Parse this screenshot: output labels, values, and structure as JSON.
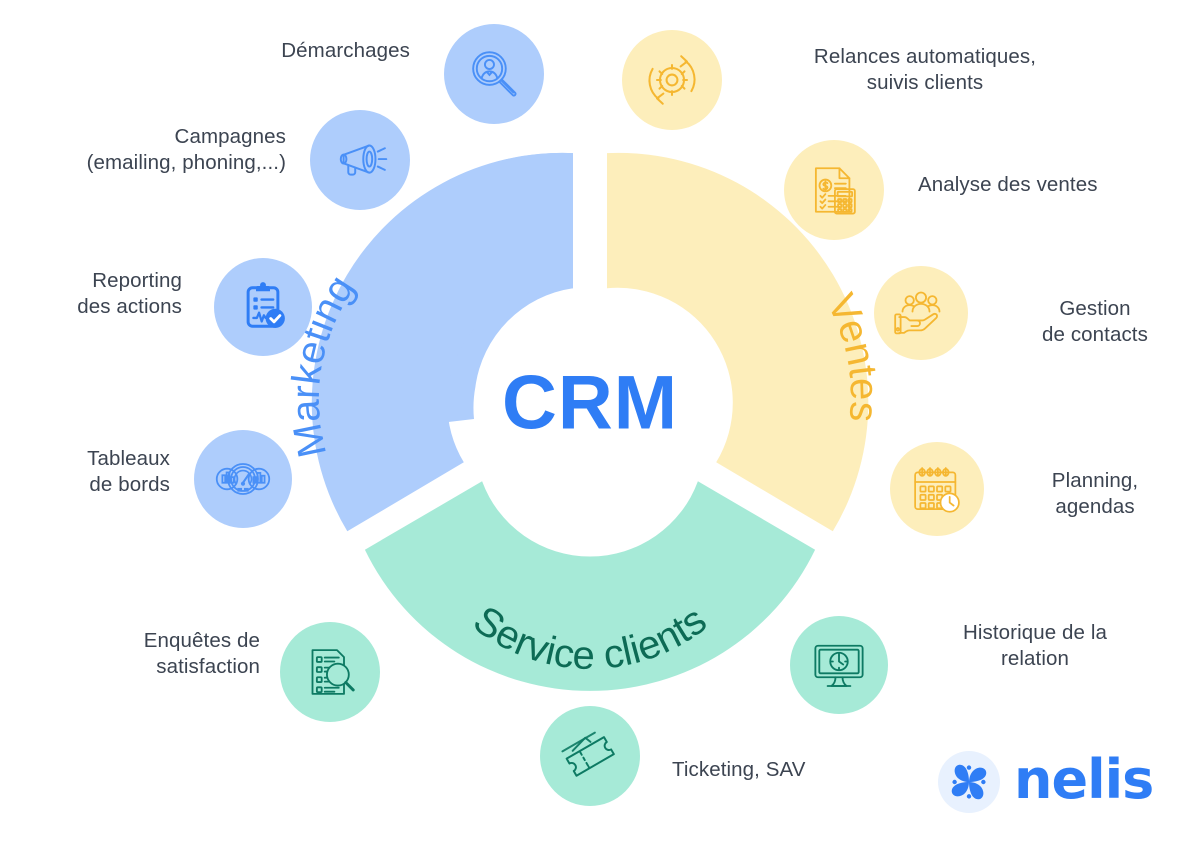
{
  "center": {
    "title": "CRM",
    "title_color": "#2f7df5"
  },
  "segments": [
    {
      "id": "marketing",
      "label": "Marketing",
      "fill": "#aecdfc",
      "text_color": "#4a90f7"
    },
    {
      "id": "ventes",
      "label": "Ventes",
      "fill": "#fdeebb",
      "text_color": "#f5b731"
    },
    {
      "id": "service-clients",
      "label": "Service clients",
      "fill": "#a6ead7",
      "text_color": "#0d6b55"
    }
  ],
  "features": [
    {
      "id": "demarchages",
      "label": "Démarchages",
      "group": "marketing",
      "icon": "person-magnifier-icon",
      "bubble_color": "#aecdfc",
      "icon_color": "#4a90f7"
    },
    {
      "id": "campagnes",
      "label": "Campagnes\n(emailing, phoning,...)",
      "group": "marketing",
      "icon": "megaphone-icon",
      "bubble_color": "#aecdfc",
      "icon_color": "#4a90f7"
    },
    {
      "id": "reporting-des-actions",
      "label": "Reporting\ndes actions",
      "group": "marketing",
      "icon": "clipboard-check-icon",
      "bubble_color": "#aecdfc",
      "icon_color": "#2f7df5"
    },
    {
      "id": "tableaux-de-bords",
      "label": "Tableaux\nde bords",
      "group": "marketing",
      "icon": "dashboard-gauge-icon",
      "bubble_color": "#aecdfc",
      "icon_color": "#4a90f7"
    },
    {
      "id": "relances-automatiques",
      "label": "Relances automatiques,\nsuivis clients",
      "group": "ventes",
      "icon": "gear-refresh-icon",
      "bubble_color": "#fdeebb",
      "icon_color": "#f5b731"
    },
    {
      "id": "analyse-des-ventes",
      "label": "Analyse des ventes",
      "group": "ventes",
      "icon": "invoice-calculator-icon",
      "bubble_color": "#fdeebb",
      "icon_color": "#f5b731"
    },
    {
      "id": "gestion-de-contacts",
      "label": "Gestion\nde contacts",
      "group": "ventes",
      "icon": "hand-people-icon",
      "bubble_color": "#fdeebb",
      "icon_color": "#f5b731"
    },
    {
      "id": "planning-agendas",
      "label": "Planning,\nagendas",
      "group": "ventes",
      "icon": "calendar-clock-icon",
      "bubble_color": "#fdeebb",
      "icon_color": "#f5b731"
    },
    {
      "id": "enquetes-de-satisfaction",
      "label": "Enquêtes de\nsatisfaction",
      "group": "service-clients",
      "icon": "survey-magnifier-icon",
      "bubble_color": "#a6ead7",
      "icon_color": "#0d7a63"
    },
    {
      "id": "ticketing-sav",
      "label": "Ticketing, SAV",
      "group": "service-clients",
      "icon": "tickets-icon",
      "bubble_color": "#a6ead7",
      "icon_color": "#0d7a63"
    },
    {
      "id": "historique-de-la-relation",
      "label": "Historique de la\nrelation",
      "group": "service-clients",
      "icon": "monitor-clock-icon",
      "bubble_color": "#a6ead7",
      "icon_color": "#0d7a63"
    }
  ],
  "brand": {
    "name": "nelis",
    "mark": "nelis-butterfly-icon",
    "color": "#2f7df5",
    "mark_bg": "#e8f1fe"
  }
}
